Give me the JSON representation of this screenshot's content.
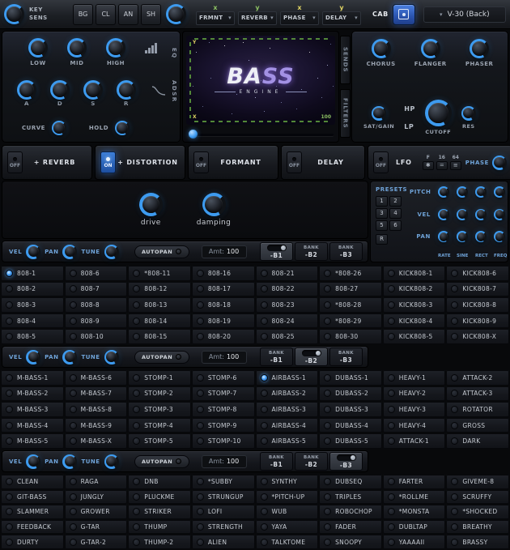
{
  "colors": {
    "accent": "#3d9bf0",
    "axis_green": "#8cc063",
    "axis_yellow": "#ded263",
    "label_blue": "#6fa3d8",
    "cab_blue": "#2a53ae"
  },
  "topbar": {
    "key_sens": "KEY SENS",
    "mode_buttons": [
      "BG",
      "CL",
      "AN",
      "SH"
    ],
    "mod_dropdowns": [
      {
        "axis": "x",
        "label": "FRMNT"
      },
      {
        "axis": "y",
        "label": "REVERB"
      },
      {
        "axis": "x",
        "label": "PHASE"
      },
      {
        "axis": "y",
        "label": "DELAY"
      }
    ],
    "cab_label": "CAB",
    "cabinet_value": "V-30 (Back)"
  },
  "eq": {
    "label": "EQ",
    "knobs": [
      "LOW",
      "MID",
      "HIGH"
    ]
  },
  "adsr": {
    "label": "ADSR",
    "knobs": [
      "A",
      "D",
      "S",
      "R"
    ],
    "extra": [
      "CURVE",
      "HOLD"
    ]
  },
  "xy": {
    "logo_a": "BA",
    "logo_b": "SS",
    "logo_sub": "ENGINE",
    "y_label": "Y",
    "x_label": "X",
    "max_value": "100"
  },
  "tabs": {
    "sends": "SENDS",
    "filters": "FILTERS"
  },
  "sends": {
    "buttons": [
      "CHORUS",
      "FLANGER",
      "PHASER"
    ]
  },
  "filters": {
    "hp": "HP",
    "lp": "LP",
    "knobs": [
      "SAT/GAIN",
      "CUTOFF",
      "RES"
    ]
  },
  "fx_slots": [
    {
      "state": "OFF",
      "label": "+ REVERB"
    },
    {
      "state": "ON",
      "label": "+ DISTORTION"
    },
    {
      "state": "OFF",
      "label": "FORMANT"
    },
    {
      "state": "OFF",
      "label": "DELAY"
    }
  ],
  "lfo": {
    "state": "OFF",
    "label": "LFO",
    "dividers": [
      "F",
      "16",
      "64"
    ],
    "divider_glyphs": [
      "✱",
      "=",
      "≡"
    ],
    "phase_label": "PHASE"
  },
  "distortion": {
    "knobs": [
      "drive",
      "damping"
    ]
  },
  "presets": {
    "title": "PRESETS",
    "slots": [
      "1",
      "2",
      "3",
      "4",
      "5",
      "6"
    ],
    "r": "R",
    "rows": [
      "PITCH",
      "VEL",
      "PAN"
    ],
    "columns": [
      "RATE",
      "SINE",
      "RECT",
      "FREQ"
    ]
  },
  "banks": {
    "vel": "VEL",
    "pan": "PAN",
    "tune": "TUNE",
    "autopan": "AUTOPAN",
    "amt_label": "Amt:",
    "amt_value": "100",
    "bank_word": "BANK",
    "buttons": [
      "-B1",
      "-B2",
      "-B3"
    ],
    "rows": [
      {
        "selected": 0
      },
      {
        "selected": 1
      },
      {
        "selected": 2
      }
    ]
  },
  "grids": [
    {
      "selected": [
        0,
        0
      ],
      "rows": [
        [
          "808-1",
          "808-6",
          "*808-11",
          "808-16",
          "808-21",
          "*808-26",
          "KICK808-1",
          "KICK808-6"
        ],
        [
          "808-2",
          "808-7",
          "808-12",
          "808-17",
          "808-22",
          "808-27",
          "KICK808-2",
          "KICK808-7"
        ],
        [
          "808-3",
          "808-8",
          "808-13",
          "808-18",
          "808-23",
          "*808-28",
          "KICK808-3",
          "KICK808-8"
        ],
        [
          "808-4",
          "808-9",
          "808-14",
          "808-19",
          "808-24",
          "*808-29",
          "KICK808-4",
          "KICK808-9"
        ],
        [
          "808-5",
          "808-10",
          "808-15",
          "808-20",
          "808-25",
          "808-30",
          "KICK808-5",
          "KICK808-X"
        ]
      ]
    },
    {
      "selected": [
        0,
        4
      ],
      "rows": [
        [
          "M-BASS-1",
          "M-BASS-6",
          "STOMP-1",
          "STOMP-6",
          "AIRBASS-1",
          "DUBASS-1",
          "HEAVY-1",
          "ATTACK-2"
        ],
        [
          "M-BASS-2",
          "M-BASS-7",
          "STOMP-2",
          "STOMP-7",
          "AIRBASS-2",
          "DUBASS-2",
          "HEAVY-2",
          "ATTACK-3"
        ],
        [
          "M-BASS-3",
          "M-BASS-8",
          "STOMP-3",
          "STOMP-8",
          "AIRBASS-3",
          "DUBASS-3",
          "HEAVY-3",
          "ROTATOR"
        ],
        [
          "M-BASS-4",
          "M-BASS-9",
          "STOMP-4",
          "STOMP-9",
          "AIRBASS-4",
          "DUBASS-4",
          "HEAVY-4",
          "GROSS"
        ],
        [
          "M-BASS-5",
          "M-BASS-X",
          "STOMP-5",
          "STOMP-10",
          "AIRBASS-5",
          "DUBASS-5",
          "ATTACK-1",
          "DARK"
        ]
      ]
    },
    {
      "selected": null,
      "rows": [
        [
          "CLEAN",
          "RAGA",
          "DNB",
          "*SUBBY",
          "SYNTHY",
          "DUBSEQ",
          "FARTER",
          "GIVEME-8"
        ],
        [
          "GIT-BASS",
          "JUNGLY",
          "PLUCKME",
          "STRUNGUP",
          "*PITCH-UP",
          "TRIPLES",
          "*ROLLME",
          "SCRUFFY"
        ],
        [
          "SLAMMER",
          "GROWER",
          "STRIKER",
          "LOFI",
          "WUB",
          "ROBOCHOP",
          "*MONSTA",
          "*SHOCKED"
        ],
        [
          "FEEDBACK",
          "G-TAR",
          "THUMP",
          "STRENGTH",
          "YAYA",
          "FADER",
          "DUBLTAP",
          "BREATHY"
        ],
        [
          "DURTY",
          "G-TAR-2",
          "THUMP-2",
          "ALIEN",
          "TALKTOME",
          "SNOOPY",
          "YAAAAII",
          "BRASSY"
        ]
      ]
    }
  ]
}
